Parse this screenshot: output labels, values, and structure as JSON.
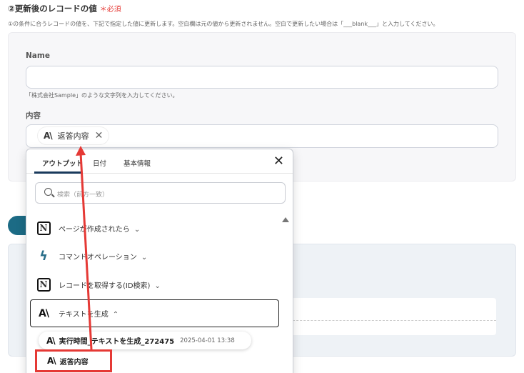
{
  "section": {
    "title": "②更新後のレコードの値",
    "required": "＊必須",
    "description": "①の条件に合うレコードの値を、下記で指定した値に更新します。空白欄は元の値から更新されません。空白で更新したい場合は「___blank___」と入力してください。"
  },
  "fields": {
    "name_label": "Name",
    "name_value": "",
    "name_hint": "「株式会社Sample」のような文字列を入力してください。",
    "content_label": "内容",
    "content_chip": "返答内容"
  },
  "dropdown": {
    "tabs": [
      {
        "label": "アウトプット",
        "active": true
      },
      {
        "label": "日付",
        "active": false
      },
      {
        "label": "基本情報",
        "active": false
      }
    ],
    "search_placeholder": "検索（前方一致）",
    "items": [
      {
        "label": "ページが作成されたら",
        "icon": "notion-icon",
        "expanded": false
      },
      {
        "label": "コマンドオペレーション",
        "icon": "command-icon",
        "expanded": false
      },
      {
        "label": "レコードを取得する(ID検索)",
        "icon": "notion-icon",
        "expanded": false
      },
      {
        "label": "テキストを生成",
        "icon": "anthropic-icon",
        "expanded": true
      }
    ],
    "subitems": [
      {
        "label": "実行時間_テキストを生成_272475",
        "date": "2025-04-01 13:38"
      },
      {
        "label": "返答内容"
      }
    ]
  },
  "colors": {
    "accent_red": "#e53935",
    "teal": "#1c6b85",
    "tab_underline": "#1a3a5c"
  }
}
